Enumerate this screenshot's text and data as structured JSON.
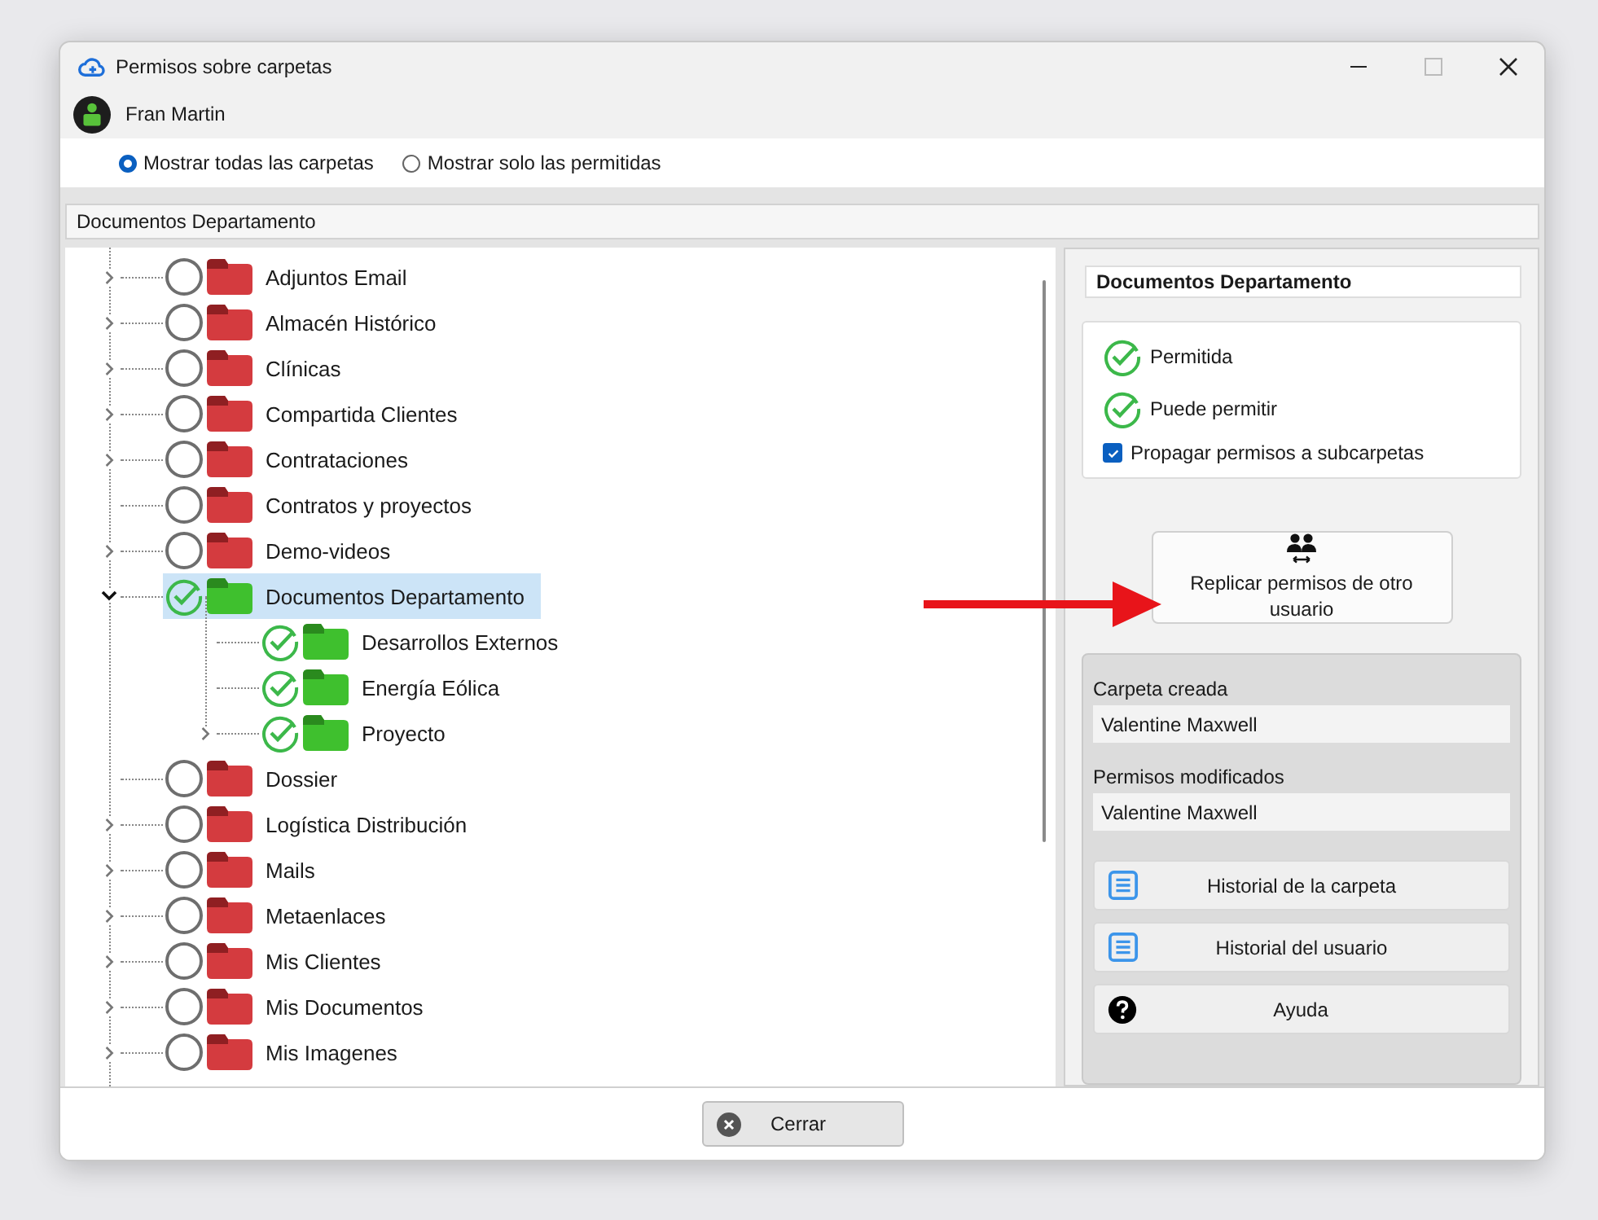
{
  "window": {
    "title": "Permisos sobre carpetas"
  },
  "user": {
    "name": "Fran Martin"
  },
  "filter_options": [
    {
      "label": "Mostrar todas las carpetas",
      "selected": true
    },
    {
      "label": "Mostrar solo las permitidas",
      "selected": false
    }
  ],
  "path": "Documentos Departamento",
  "tree": [
    {
      "label": "Adjuntos Email",
      "has_children": true,
      "permitted": false,
      "selected": false
    },
    {
      "label": "Almacén Histórico",
      "has_children": true,
      "permitted": false,
      "selected": false
    },
    {
      "label": "Clínicas",
      "has_children": true,
      "permitted": false,
      "selected": false
    },
    {
      "label": "Compartida Clientes",
      "has_children": true,
      "permitted": false,
      "selected": false
    },
    {
      "label": "Contrataciones",
      "has_children": true,
      "permitted": false,
      "selected": false
    },
    {
      "label": "Contratos y proyectos",
      "has_children": false,
      "permitted": false,
      "selected": false
    },
    {
      "label": "Demo-videos",
      "has_children": true,
      "permitted": false,
      "selected": false
    },
    {
      "label": "Documentos Departamento",
      "has_children": true,
      "permitted": true,
      "selected": true,
      "children": [
        {
          "label": "Desarrollos Externos",
          "has_children": false,
          "permitted": true,
          "selected": false
        },
        {
          "label": "Energía Eólica",
          "has_children": false,
          "permitted": true,
          "selected": false
        },
        {
          "label": "Proyecto",
          "has_children": true,
          "permitted": true,
          "selected": false
        }
      ]
    },
    {
      "label": "Dossier",
      "has_children": false,
      "permitted": false,
      "selected": false
    },
    {
      "label": "Logística Distribución",
      "has_children": true,
      "permitted": false,
      "selected": false
    },
    {
      "label": "Mails",
      "has_children": true,
      "permitted": false,
      "selected": false
    },
    {
      "label": "Metaenlaces",
      "has_children": true,
      "permitted": false,
      "selected": false
    },
    {
      "label": "Mis Clientes",
      "has_children": true,
      "permitted": false,
      "selected": false
    },
    {
      "label": "Mis Documentos",
      "has_children": true,
      "permitted": false,
      "selected": false
    },
    {
      "label": "Mis Imagenes",
      "has_children": true,
      "permitted": false,
      "selected": false
    }
  ],
  "details": {
    "folder_name": "Documentos Departamento",
    "permissions": [
      {
        "label": "Permitida",
        "granted": true
      },
      {
        "label": "Puede permitir",
        "granted": true
      }
    ],
    "propagate": {
      "label": "Propagar permisos a subcarpetas",
      "checked": true
    },
    "replicate_button": "Replicar permisos de otro usuario",
    "info": [
      {
        "label": "Carpeta creada",
        "value": "Valentine Maxwell"
      },
      {
        "label": "Permisos modificados",
        "value": "Valentine Maxwell"
      }
    ],
    "actions": [
      {
        "label": "Historial de la carpeta",
        "kind": "history"
      },
      {
        "label": "Historial del usuario",
        "kind": "history"
      },
      {
        "label": "Ayuda",
        "kind": "help"
      }
    ]
  },
  "close_button": "Cerrar"
}
